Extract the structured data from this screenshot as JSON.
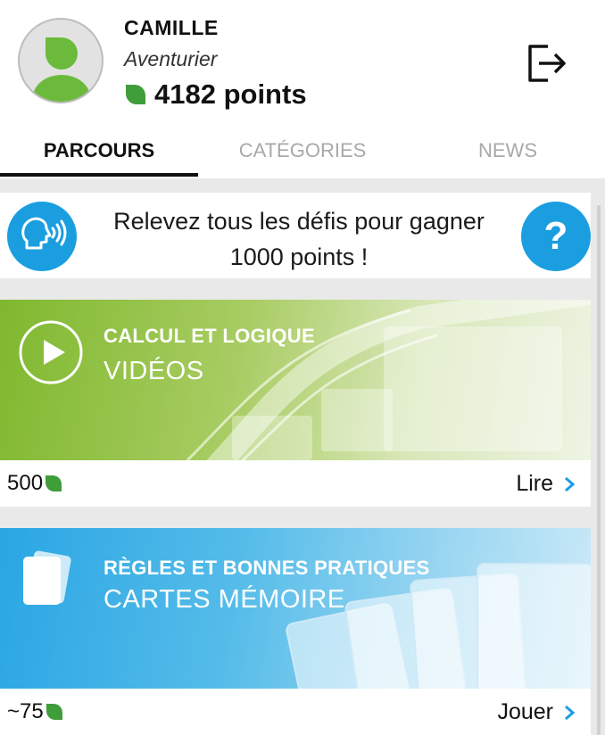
{
  "user": {
    "name": "CAMILLE",
    "level": "Aventurier",
    "points": "4182 points"
  },
  "tabs": [
    {
      "label": "PARCOURS",
      "active": true
    },
    {
      "label": "CATÉGORIES",
      "active": false
    },
    {
      "label": "NEWS",
      "active": false
    }
  ],
  "challenge": {
    "text": "Relevez tous les défis pour gagner 1000 points !",
    "help_symbol": "?"
  },
  "cards": [
    {
      "category": "CALCUL ET LOGIQUE",
      "type": "VIDÉOS",
      "reward": "500",
      "action": "Lire",
      "icon": "play-icon",
      "color": "#7fb82e"
    },
    {
      "category": "RÈGLES ET BONNES PRATIQUES",
      "type": "CARTES MÉMOIRE",
      "reward": "~75",
      "action": "Jouer",
      "icon": "cards-icon",
      "color": "#2aa6e4"
    }
  ],
  "colors": {
    "accent_blue": "#1a9ee0",
    "leaf_green": "#3f9d3a",
    "avatar_green": "#6cba3c"
  }
}
